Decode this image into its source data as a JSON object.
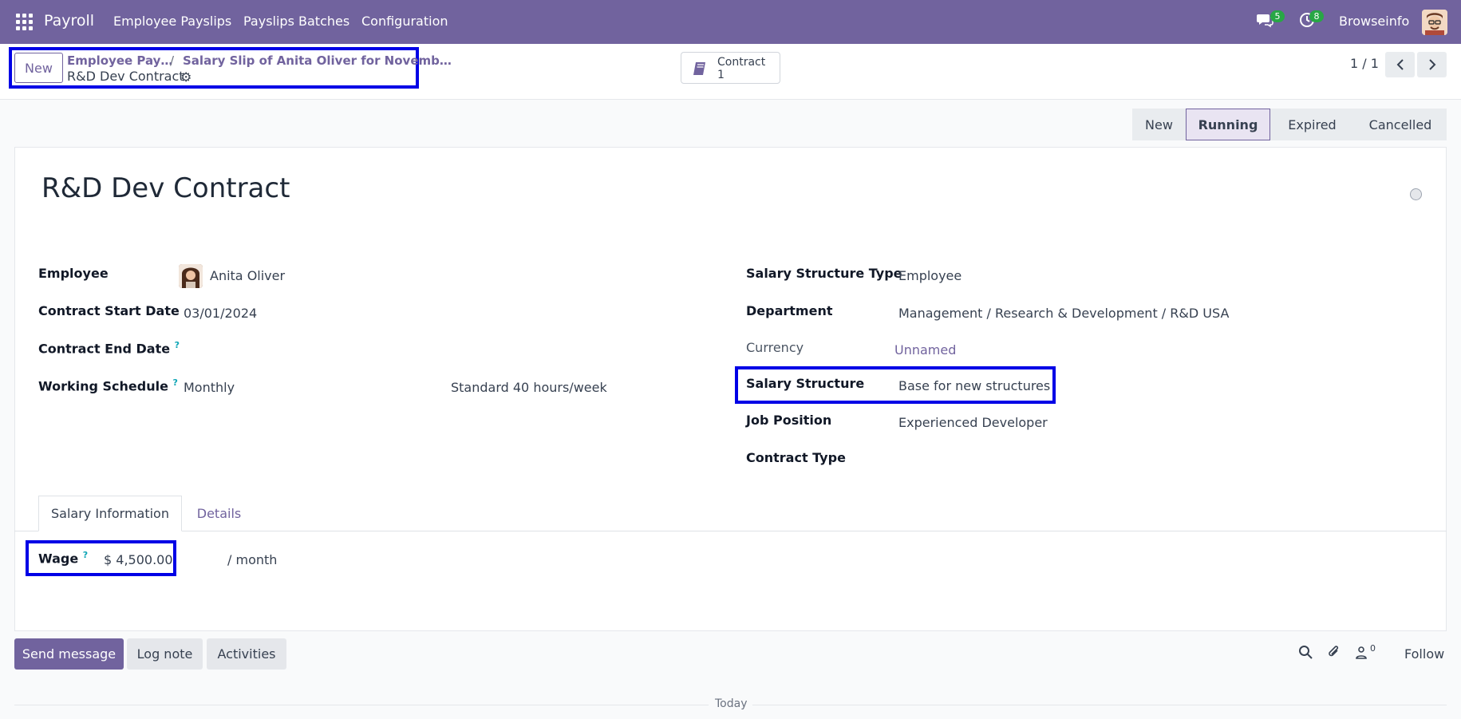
{
  "navbar": {
    "app_title": "Payroll",
    "menu": [
      "Employee Payslips",
      "Payslips Batches",
      "Configuration"
    ],
    "messages_count": "5",
    "activities_count": "8",
    "user": "Browseinfo"
  },
  "control_panel": {
    "new_label": "New",
    "breadcrumb_1": "Employee Pay…",
    "breadcrumb_sep": "/",
    "breadcrumb_2": "Salary Slip of Anita Oliver for Novemb…",
    "current": "R&D Dev Contract",
    "smart_button": {
      "label": "Contract",
      "count": "1"
    },
    "pager": "1 / 1"
  },
  "statusbar": {
    "stages": [
      "New",
      "Running",
      "Expired",
      "Cancelled"
    ],
    "active": "Running"
  },
  "form": {
    "title": "R&D Dev Contract",
    "left": {
      "employee_label": "Employee",
      "employee_value": "Anita Oliver",
      "start_label": "Contract Start Date",
      "start_value": "03/01/2024",
      "end_label": "Contract End Date",
      "schedule_label": "Working Schedule",
      "schedule_value": "Monthly",
      "schedule_hours": "Standard 40 hours/week",
      "help_mark": "?"
    },
    "right": {
      "structure_type_label": "Salary Structure Type",
      "structure_type_value": "Employee",
      "department_label": "Department",
      "department_value": "Management / Research & Development / R&D USA",
      "currency_label": "Currency",
      "currency_value": "Unnamed",
      "structure_label": "Salary Structure",
      "structure_value": "Base for new structures",
      "job_label": "Job Position",
      "job_value": "Experienced Developer",
      "contract_type_label": "Contract Type"
    },
    "tabs": [
      "Salary Information",
      "Details"
    ],
    "wage_label": "Wage",
    "wage_value": "$ 4,500.00",
    "wage_period": "/ month"
  },
  "chatter": {
    "send_message": "Send message",
    "log_note": "Log note",
    "activities": "Activities",
    "followers_count": "0",
    "follow": "Follow",
    "today": "Today"
  },
  "colors": {
    "brand": "#71639e",
    "highlight": "#0000e6",
    "badge": "#28a745"
  }
}
